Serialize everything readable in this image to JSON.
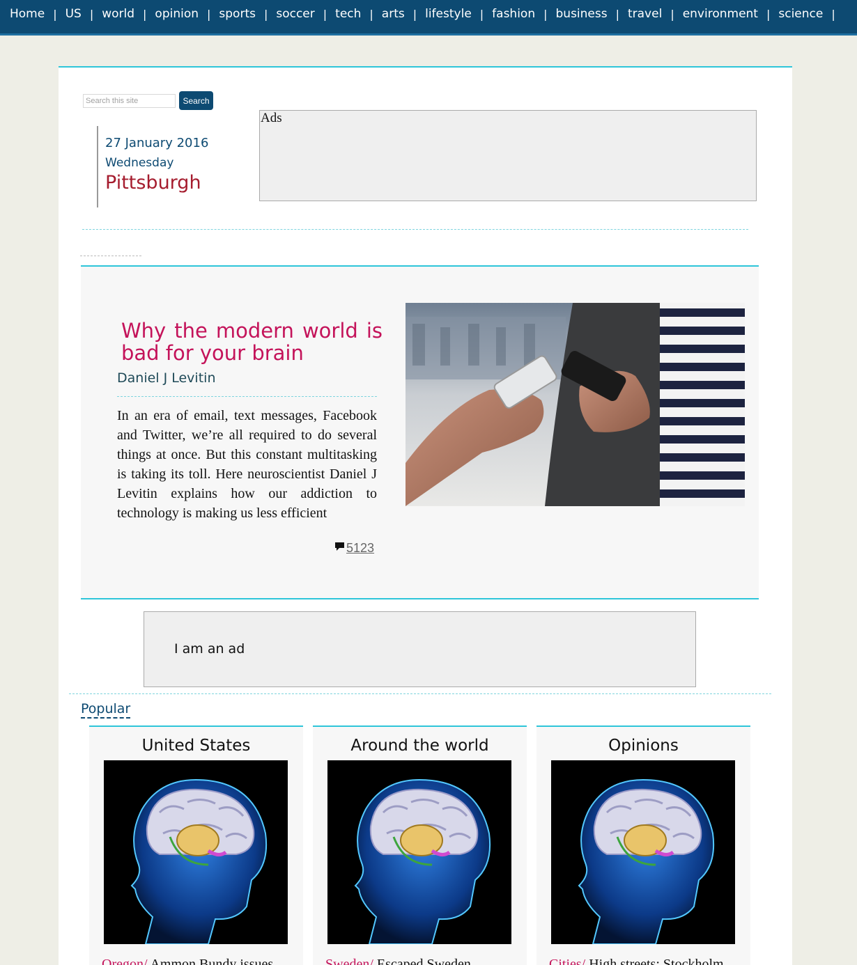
{
  "nav": {
    "items": [
      "Home",
      "US",
      "world",
      "opinion",
      "sports",
      "soccer",
      "tech",
      "arts",
      "lifestyle",
      "fashion",
      "business",
      "travel",
      "environment",
      "science"
    ],
    "separator": "|"
  },
  "search": {
    "placeholder": "Search this site",
    "button_label": "Search"
  },
  "dateline": {
    "date": "27 January 2016",
    "weekday": "Wednesday",
    "city": "Pittsburgh"
  },
  "ads": {
    "top_label": "Ads",
    "inline_text": "I am an ad"
  },
  "featured": {
    "title": "Why the modern world is bad for your brain",
    "author": "Daniel J Levitin",
    "summary": "In an era of email, text messages, Facebook and Twitter, we’re all required to do several things at once. But this constant multitasking is taking its toll. Here neuroscientist Daniel J Levitin explains how our addiction to technology is making us less efficient",
    "comment_count": "5123",
    "image_icon": "people-with-smartphones-photo"
  },
  "popular": {
    "heading": "Popular",
    "cards": [
      {
        "heading": "United States",
        "category": "Oregon/",
        "headline": "Ammon Bundy issues",
        "image_icon": "brain-scan-illustration"
      },
      {
        "heading": "Around the world",
        "category": "Sweden/",
        "headline": "Escaped Sweden",
        "image_icon": "brain-scan-illustration"
      },
      {
        "heading": "Opinions",
        "category": "Cities/",
        "headline": "High streets: Stockholm",
        "image_icon": "brain-scan-illustration"
      }
    ]
  },
  "colors": {
    "nav_bg": "#0d4a72",
    "accent": "#2ec5d9",
    "headline": "#c4135a",
    "city": "#a51c2e"
  }
}
